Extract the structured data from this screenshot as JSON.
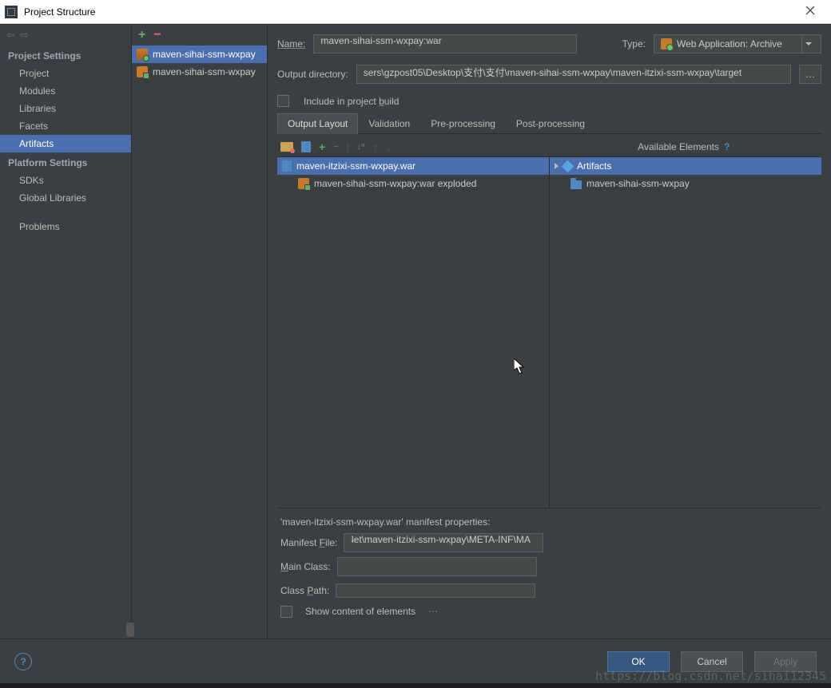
{
  "window": {
    "title": "Project Structure"
  },
  "nav": {
    "group1": "Project Settings",
    "items1": [
      "Project",
      "Modules",
      "Libraries",
      "Facets",
      "Artifacts"
    ],
    "group2": "Platform Settings",
    "items2": [
      "SDKs",
      "Global Libraries"
    ],
    "extra": [
      "Problems"
    ]
  },
  "artifacts": {
    "list": [
      {
        "label": "maven-sihai-ssm-wxpay",
        "kind": "war"
      },
      {
        "label": "maven-sihai-ssm-wxpay",
        "kind": "exploded"
      }
    ]
  },
  "form": {
    "name_label": "Name:",
    "name": "maven-sihai-ssm-wxpay:war",
    "type_label": "Type:",
    "type": "Web Application: Archive",
    "outdir_label": "Output directory:",
    "outdir": "sers\\gzpost05\\Desktop\\支付\\支付\\maven-sihai-ssm-wxpay\\maven-itzixi-ssm-wxpay\\target",
    "include": "Include in project build"
  },
  "tabs": [
    "Output Layout",
    "Validation",
    "Pre-processing",
    "Post-processing"
  ],
  "layout": {
    "available_label": "Available Elements",
    "tree": [
      {
        "label": "maven-itzixi-ssm-wxpay.war",
        "kind": "archive",
        "selected": true
      },
      {
        "label": "maven-sihai-ssm-wxpay:war exploded",
        "kind": "exploded"
      }
    ],
    "right_tree": [
      {
        "label": "Artifacts",
        "kind": "group",
        "selected": true
      },
      {
        "label": "maven-sihai-ssm-wxpay",
        "kind": "module"
      }
    ]
  },
  "manifest": {
    "header": "'maven-itzixi-ssm-wxpay.war' manifest properties:",
    "file_label": "Manifest File:",
    "file": "ʇet\\maven-itzixi-ssm-wxpay\\META-INF\\MA",
    "main_label": "Main Class:",
    "main": "",
    "cp_label": "Class Path:",
    "show": "Show content of elements"
  },
  "buttons": {
    "ok": "OK",
    "cancel": "Cancel",
    "apply": "Apply"
  },
  "watermark": "https://blog.csdn.net/sihai12345"
}
